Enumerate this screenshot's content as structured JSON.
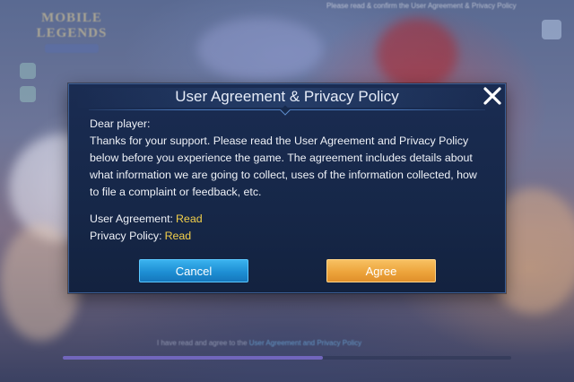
{
  "background": {
    "game_logo_text": "MOBILE LEGENDS",
    "top_notice": "Please read & confirm the User Agreement & Privacy Policy",
    "bottom_notice_prefix": "I have read and agree to the ",
    "bottom_notice_link": "User Agreement and Privacy Policy",
    "loading_progress": 0.58
  },
  "dialog": {
    "title": "User Agreement & Privacy Policy",
    "greeting": "Dear player:",
    "message": "Thanks for your support. Please read the User Agreement and Privacy Policy below before you experience the game. The agreement includes details about what information we are going to collect, uses of the information collected, how to file a complaint or feedback, etc.",
    "user_agreement_label": "User Agreement:",
    "user_agreement_link": "Read",
    "privacy_policy_label": "Privacy Policy:",
    "privacy_policy_link": "Read",
    "cancel_label": "Cancel",
    "agree_label": "Agree",
    "close_icon": "close-icon"
  },
  "colors": {
    "dialog_bg": "#1a2c52",
    "link": "#f2cf4a",
    "cancel_button": "#1e8fd4",
    "agree_button": "#eda53c"
  }
}
